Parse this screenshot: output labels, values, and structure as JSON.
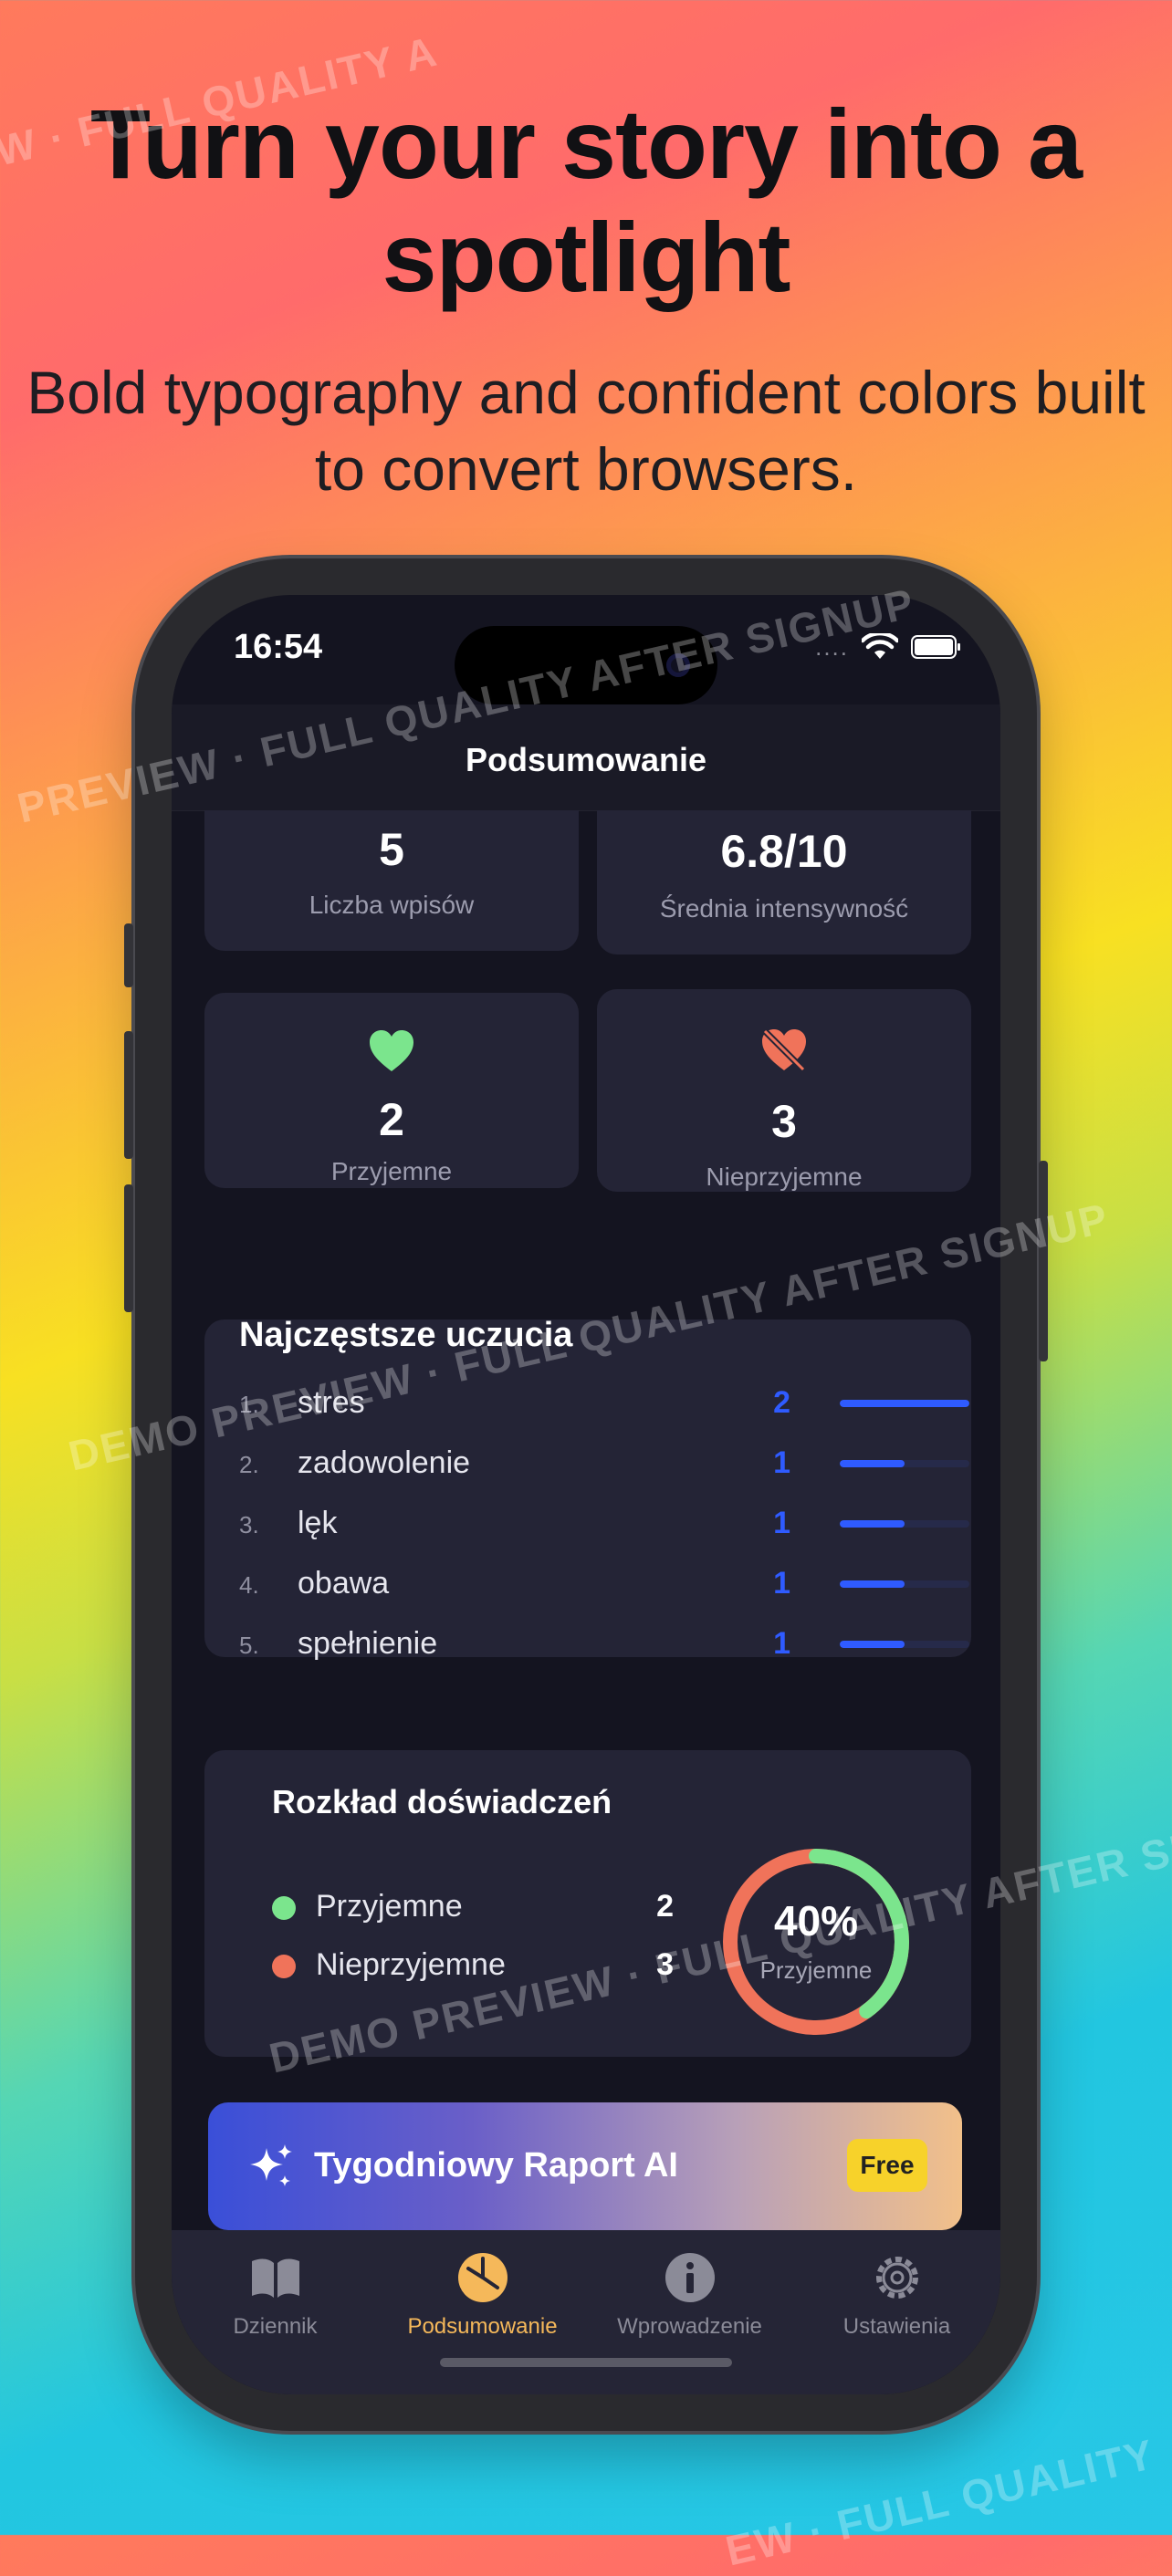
{
  "promo": {
    "headline": "Turn your story into a spotlight",
    "subhead": "Bold typography and confident colors built to convert browsers."
  },
  "status_bar": {
    "time": "16:54",
    "signal_text": "....",
    "wifi_icon": "wifi-icon",
    "battery_icon": "battery-icon"
  },
  "nav": {
    "title": "Podsumowanie"
  },
  "stats": [
    {
      "value": "5",
      "label": "Liczba wpisów"
    },
    {
      "value": "6.8/10",
      "label": "Średnia intensywność"
    },
    {
      "value": "2",
      "label": "Przyjemne",
      "icon": "heart-icon",
      "color": "#7be58d"
    },
    {
      "value": "3",
      "label": "Nieprzyjemne",
      "icon": "heart-slash-icon",
      "color": "#f0735a"
    }
  ],
  "top_feelings": {
    "title": "Najczęstsze uczucia",
    "items": [
      {
        "rank": "1.",
        "name": "stres",
        "count": "2",
        "share": 1.0
      },
      {
        "rank": "2.",
        "name": "zadowolenie",
        "count": "1",
        "share": 0.5
      },
      {
        "rank": "3.",
        "name": "lęk",
        "count": "1",
        "share": 0.5
      },
      {
        "rank": "4.",
        "name": "obawa",
        "count": "1",
        "share": 0.5
      },
      {
        "rank": "5.",
        "name": "spełnienie",
        "count": "1",
        "share": 0.5
      }
    ],
    "bar_color": "#2f5bff"
  },
  "distribution": {
    "title": "Rozkład doświadczeń",
    "legend": [
      {
        "label": "Przyjemne",
        "value": "2",
        "color": "#7be58d"
      },
      {
        "label": "Nieprzyjemne",
        "value": "3",
        "color": "#f0735a"
      }
    ],
    "donut_percent": "40%",
    "donut_label": "Przyjemne",
    "pleasant_fraction": 0.4
  },
  "ai_banner": {
    "title": "Tygodniowy Raport AI",
    "badge": "Free",
    "icon": "sparkles-icon"
  },
  "tabs": [
    {
      "label": "Dziennik",
      "icon": "book-icon",
      "active": false
    },
    {
      "label": "Podsumowanie",
      "icon": "pie-chart-icon",
      "active": true
    },
    {
      "label": "Wprowadzenie",
      "icon": "info-icon",
      "active": false
    },
    {
      "label": "Ustawienia",
      "icon": "gear-icon",
      "active": false
    }
  ],
  "watermarks": [
    "W · FULL QUALITY A",
    "PREVIEW · FULL QUALITY AFTER SIGNUP",
    "DEMO PREVIEW · FULL QUALITY AFTER SIGNUP",
    "DEMO PREVIEW · FULL QUALITY AFTER SI",
    "EW · FULL QUALITY"
  ],
  "colors": {
    "accent_active": "#f5b85a",
    "screen_bg": "#141420",
    "card_bg": "#242436"
  }
}
